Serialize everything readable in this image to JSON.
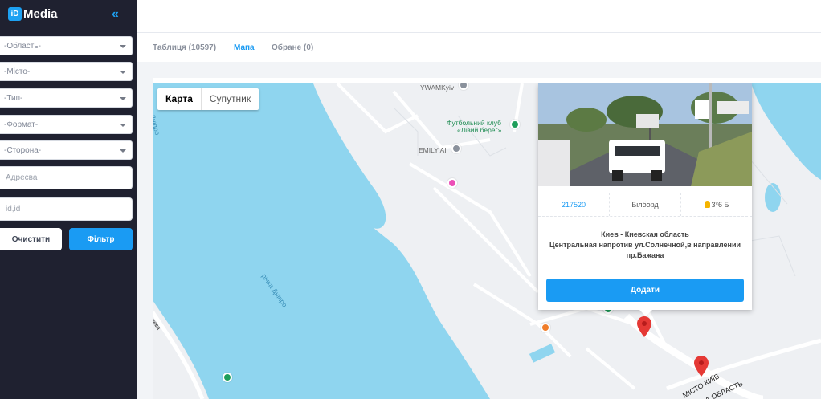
{
  "brand": {
    "badge": "iD",
    "name": "Media"
  },
  "sidebar": {
    "collapse_glyph": "«",
    "selects": [
      {
        "label": "-Область-"
      },
      {
        "label": "-Місто-"
      },
      {
        "label": "-Тип-"
      },
      {
        "label": "-Формат-"
      },
      {
        "label": "-Сторона-"
      }
    ],
    "address_placeholder": "Адресва",
    "ids_placeholder": "id,id",
    "clear_label": "Очистити",
    "filter_label": "Фільтр"
  },
  "tabs": [
    {
      "label": "Таблиця (10597)"
    },
    {
      "label": "Мапа",
      "active": true
    },
    {
      "label": "Обране (0)"
    }
  ],
  "map": {
    "type_map": "Карта",
    "type_satellite": "Супутник",
    "pois": {
      "ywam": "YWAMKyiv",
      "football": "Футбольний клуб",
      "football2": "«Лівий берег»",
      "emily": "EMILY AI"
    },
    "water": {
      "dnipro_top": "р. Дніпро",
      "dnipro_river": "річка Дніпро"
    },
    "roads": {
      "left_road": "чева",
      "city": "МІСТО КИЇВ",
      "region": "А ОБЛАСТЬ"
    },
    "colors": {
      "water": "#8fd5ef",
      "land": "#eef0f3",
      "road": "#ffffff",
      "pin": "#e53935"
    }
  },
  "popup": {
    "id": "217520",
    "type": "Білборд",
    "size": "3*6 Б",
    "address_line1": "Киев - Киевская область",
    "address_line2": "Центральная напротив ул.Солнечной,в направлении",
    "address_line3": "пр.Бажана",
    "add_label": "Додати"
  }
}
